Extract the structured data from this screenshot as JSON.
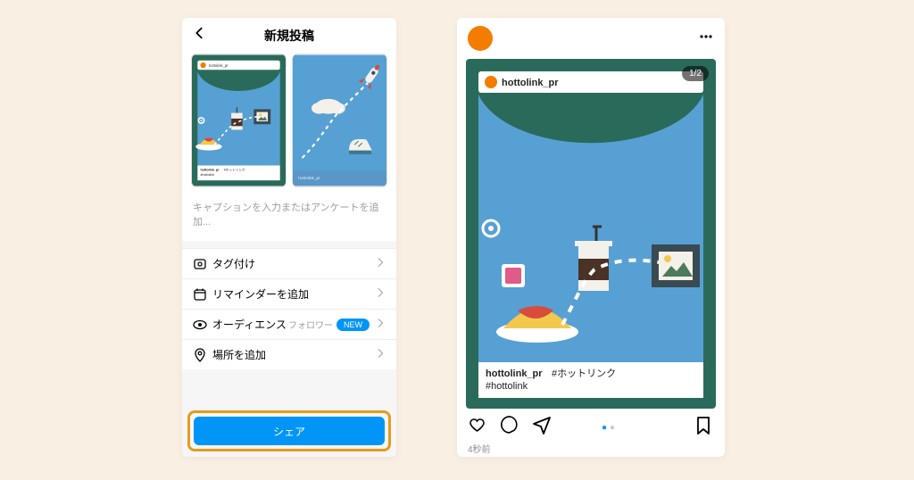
{
  "header": {
    "title": "新規投稿"
  },
  "caption_placeholder": "キャプションを入力またはアンケートを追加...",
  "options": {
    "tag": {
      "label": "タグ付け"
    },
    "reminder": {
      "label": "リマインダーを追加"
    },
    "audience": {
      "label": "オーディエンス",
      "sub": "フォロワー",
      "badge": "NEW"
    },
    "location": {
      "label": "場所を追加"
    }
  },
  "share_button": "シェア",
  "feed": {
    "counter": "1/2",
    "card": {
      "username": "hottolink_pr",
      "caption_user": "hottolink_pr",
      "caption_tags": "#ホットリンク",
      "caption_tags_2": "#hottolink"
    },
    "timestamp": "4秒前"
  },
  "colors": {
    "accent_blue": "#0095f6",
    "highlight_orange": "#e69a1f",
    "avatar_orange": "#f47c00",
    "dark_green": "#2a6a5a",
    "sky_blue": "#57a0d3"
  }
}
